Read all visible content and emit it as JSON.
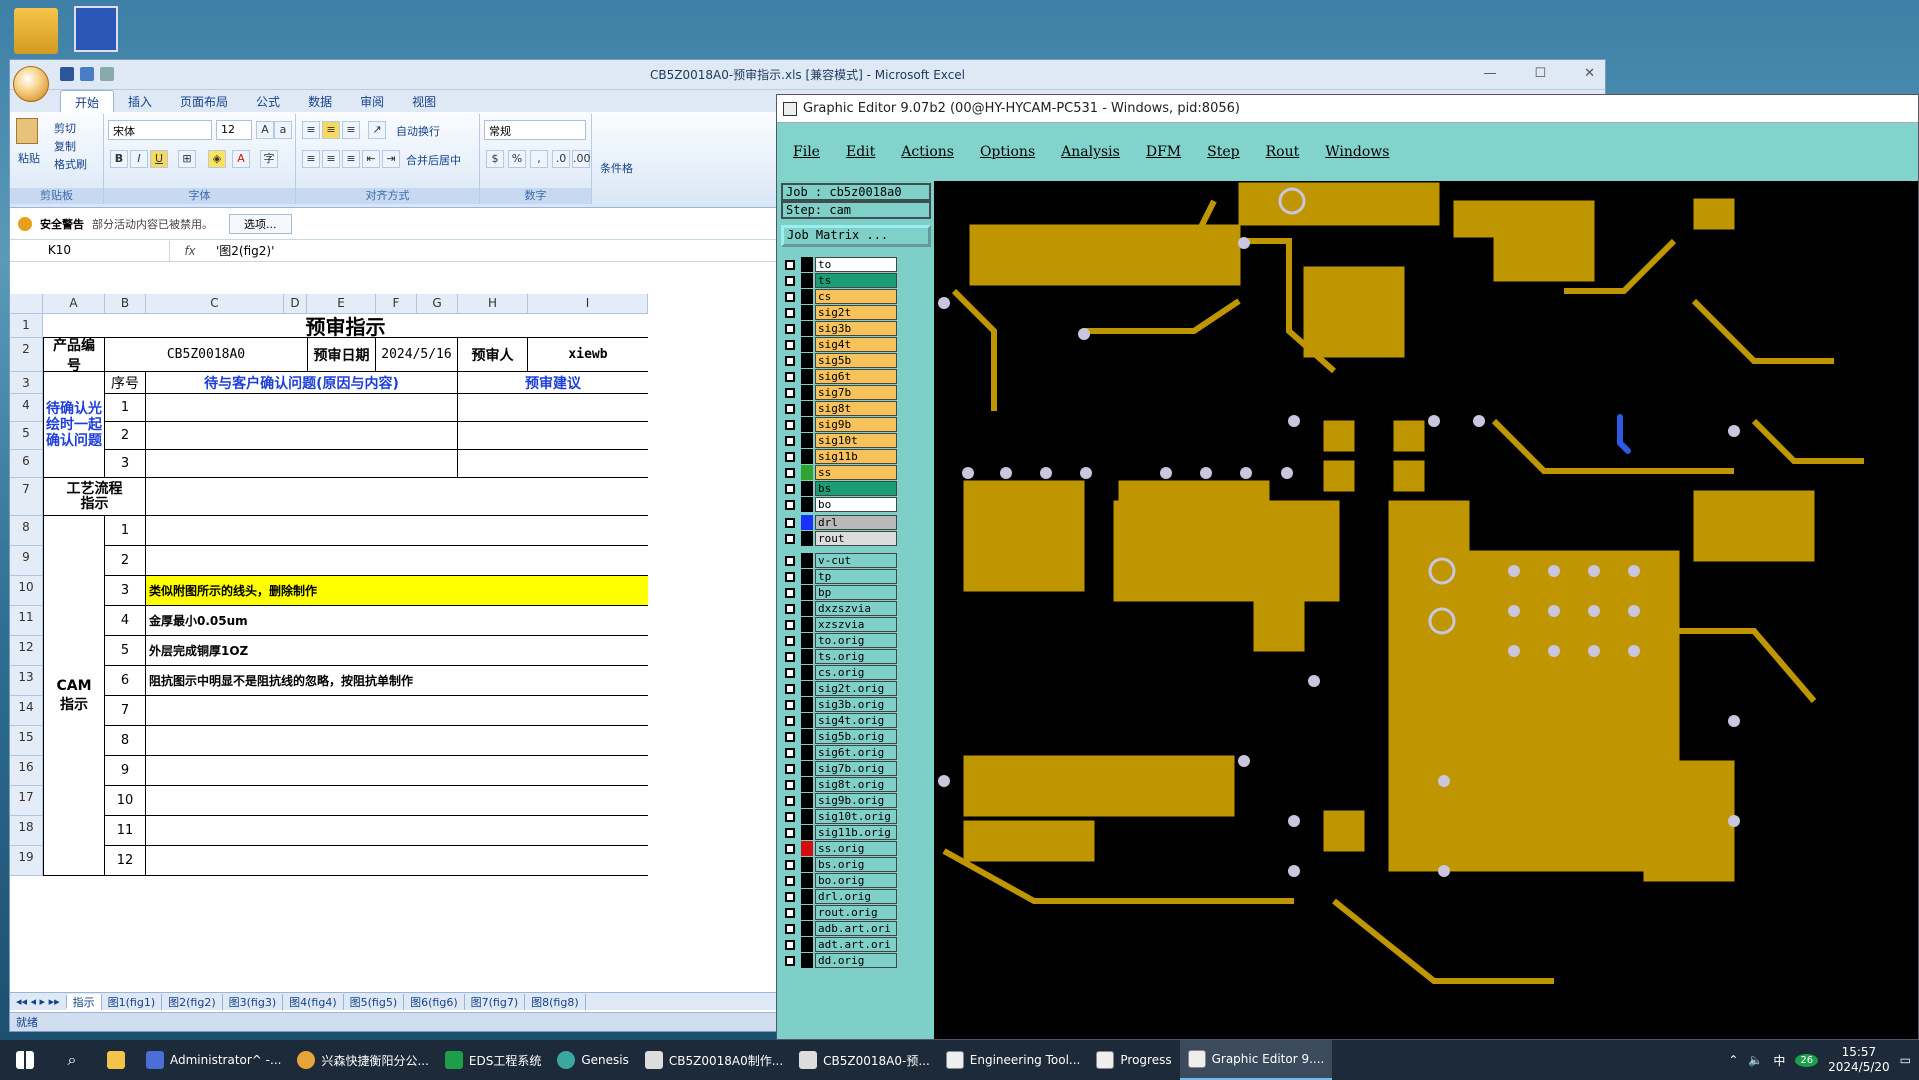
{
  "excel": {
    "title": "CB5Z0018A0-预审指示.xls [兼容模式] - Microsoft Excel",
    "tabs": [
      "开始",
      "插入",
      "页面布局",
      "公式",
      "数据",
      "审阅",
      "视图"
    ],
    "clipboard": {
      "paste": "粘贴",
      "cut": "剪切",
      "copy": "复制",
      "format_painter": "格式刷",
      "label": "剪贴板"
    },
    "font": {
      "name": "宋体",
      "size": "12",
      "label": "字体"
    },
    "align": {
      "wrap": "自动换行",
      "merge": "合并后居中",
      "label": "对齐方式"
    },
    "number": {
      "format": "常规",
      "label": "数字"
    },
    "styles_label": "条件格",
    "security": {
      "title": "安全警告",
      "message": "部分活动内容已被禁用。",
      "button": "选项..."
    },
    "namebox": "K10",
    "fx": "fx",
    "formula": "'图2(fig2)'",
    "columns": [
      "A",
      "B",
      "C",
      "D",
      "E",
      "F",
      "G",
      "H",
      "I"
    ],
    "rows": [
      "1",
      "2",
      "3",
      "4",
      "5",
      "6",
      "7",
      "8",
      "9",
      "10",
      "11",
      "12",
      "13",
      "14",
      "15",
      "16",
      "17",
      "18",
      "19"
    ],
    "sheet": {
      "title": "预审指示",
      "product_label": "产品编号",
      "product_value": "CB5Z0018A0",
      "date_label": "预审日期",
      "date_value": "2024/5/16",
      "reviewer_label": "预审人",
      "reviewer_value": "xiewb",
      "seq_header": "序号",
      "issue_header": "待与客户确认问题(原因与内容)",
      "suggest_header": "预审建议",
      "pending_label": "待确认光绘时一起确认问题",
      "pending_rows": [
        "1",
        "2",
        "3"
      ],
      "process_label": "工艺流程指示",
      "cam_label": "CAM指示",
      "cam_rows": [
        {
          "n": "1",
          "text": ""
        },
        {
          "n": "2",
          "text": ""
        },
        {
          "n": "3",
          "text": "类似附图所示的线头，删除制作"
        },
        {
          "n": "4",
          "text": "金厚最小0.05um"
        },
        {
          "n": "5",
          "text": "外层完成铜厚1OZ"
        },
        {
          "n": "6",
          "text": "阻抗图示中明显不是阻抗线的忽略，按阻抗单制作"
        },
        {
          "n": "7",
          "text": ""
        },
        {
          "n": "8",
          "text": ""
        },
        {
          "n": "9",
          "text": ""
        },
        {
          "n": "10",
          "text": ""
        },
        {
          "n": "11",
          "text": ""
        },
        {
          "n": "12",
          "text": ""
        }
      ]
    },
    "sheet_tabs": [
      "指示",
      "图1(fig1)",
      "图2(fig2)",
      "图3(fig3)",
      "图4(fig4)",
      "图5(fig5)",
      "图6(fig6)",
      "图7(fig7)",
      "图8(fig8)"
    ],
    "status": "就绪"
  },
  "genesis": {
    "title": "Graphic Editor 9.07b2 (00@HY-HYCAM-PC531 - Windows, pid:8056)",
    "menu": [
      "File",
      "Edit",
      "Actions",
      "Options",
      "Analysis",
      "DFM",
      "Step",
      "Rout",
      "Windows"
    ],
    "job": "Job : cb5z0018a0",
    "step": "Step: cam",
    "job_matrix": "Job Matrix ...",
    "layers": [
      {
        "name": "to",
        "color": "#ffffff"
      },
      {
        "name": "ts",
        "color": "#1a9e76"
      },
      {
        "name": "cs",
        "color": "#f7c25a"
      },
      {
        "name": "sig2t",
        "color": "#f7c25a"
      },
      {
        "name": "sig3b",
        "color": "#f7c25a"
      },
      {
        "name": "sig4t",
        "color": "#f7c25a"
      },
      {
        "name": "sig5b",
        "color": "#f7c25a"
      },
      {
        "name": "sig6t",
        "color": "#f7c25a"
      },
      {
        "name": "sig7b",
        "color": "#f7c25a"
      },
      {
        "name": "sig8t",
        "color": "#f7c25a"
      },
      {
        "name": "sig9b",
        "color": "#f7c25a"
      },
      {
        "name": "sig10t",
        "color": "#f7c25a"
      },
      {
        "name": "sig11b",
        "color": "#f7c25a"
      },
      {
        "name": "ss",
        "color": "#f7c25a"
      },
      {
        "name": "bs",
        "color": "#1a9e76"
      },
      {
        "name": "bo",
        "color": "#ffffff"
      }
    ],
    "drill_layers": [
      {
        "name": "drl",
        "color": "#b9b9b9"
      },
      {
        "name": "rout",
        "color": "#dcdcdc"
      }
    ],
    "misc_layers": [
      "v-cut",
      "tp",
      "bp",
      "dxzszvia",
      "xzszvia",
      "to.orig",
      "ts.orig",
      "cs.orig",
      "sig2t.orig",
      "sig3b.orig",
      "sig4t.orig",
      "sig5b.orig",
      "sig6t.orig",
      "sig7b.orig",
      "sig8t.orig",
      "sig9b.orig",
      "sig10t.orig",
      "sig11b.orig",
      "ss.orig",
      "bs.orig",
      "bo.orig",
      "drl.orig",
      "rout.orig",
      "adb.art.ori",
      "adt.art.ori",
      "dd.orig"
    ]
  },
  "taskbar": {
    "items": [
      "Administrator^ -...",
      "兴森快捷衡阳分公...",
      "EDS工程系统",
      "Genesis",
      "CB5Z0018A0制作...",
      "CB5Z0018A0-预...",
      "Engineering Tool...",
      "Progress",
      "Graphic Editor 9...."
    ],
    "ime": "中",
    "badge": "26",
    "time": "15:57",
    "date": "2024/5/20"
  },
  "colors": {
    "copper": "#bf9600",
    "pad": "#c9c6de",
    "hilite": "#ffff00",
    "excel_blue": "#1f5ebf"
  }
}
